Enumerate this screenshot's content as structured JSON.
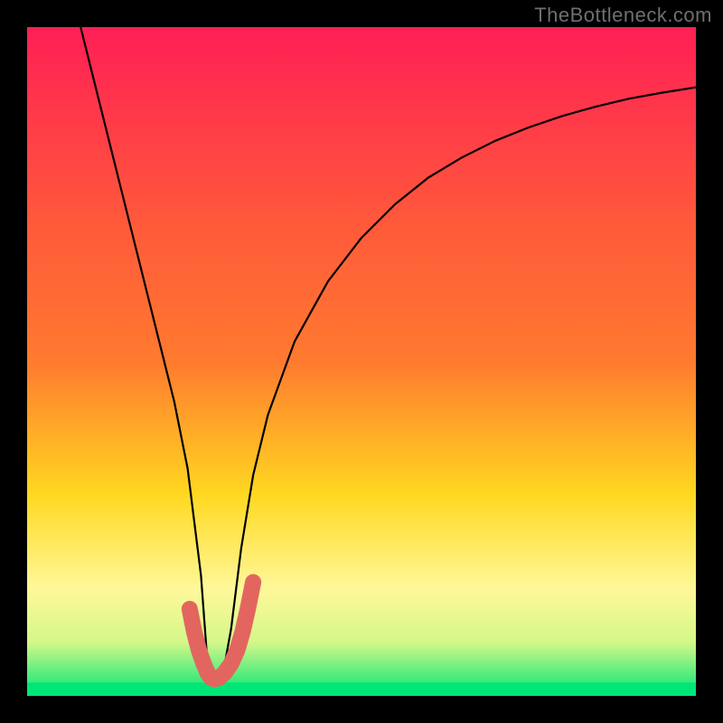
{
  "watermark": "TheBottleneck.com",
  "chart_data": {
    "type": "line",
    "title": "",
    "xlabel": "",
    "ylabel": "",
    "xlim": [
      0,
      100
    ],
    "ylim": [
      0,
      100
    ],
    "background_gradient": {
      "top": "#ff1f55",
      "mid1": "#ff7a2f",
      "mid2": "#ffd820",
      "mid3": "#fff89a",
      "bottom": "#00e676"
    },
    "series": [
      {
        "name": "bottleneck-curve",
        "color": "#000000",
        "x": [
          8,
          10,
          12,
          14,
          16,
          18,
          20,
          22,
          24,
          26,
          27.0,
          27.5,
          28.0,
          28.7,
          29.5,
          30.5,
          32.0,
          33.8,
          36.0,
          40.0,
          45.0,
          50.0,
          55.0,
          60.0,
          65.0,
          70.0,
          75.0,
          80.0,
          85.0,
          90.0,
          95.0,
          100.0
        ],
        "y": [
          100,
          92,
          84,
          76,
          68,
          60,
          52,
          44,
          34,
          18,
          4.5,
          2.8,
          2.5,
          2.8,
          4.5,
          10,
          22,
          33,
          42,
          53,
          62,
          68.5,
          73.5,
          77.5,
          80.5,
          83.0,
          85.0,
          86.7,
          88.1,
          89.3,
          90.2,
          91.0
        ]
      },
      {
        "name": "sweet-spot",
        "color": "#e2665f",
        "thick": true,
        "x": [
          24.3,
          25.0,
          25.7,
          26.4,
          27.0,
          27.5,
          28.0,
          28.7,
          29.5,
          30.5,
          31.4,
          32.2,
          33.0,
          33.8
        ],
        "y": [
          13.0,
          9.5,
          6.8,
          4.8,
          3.4,
          2.7,
          2.5,
          2.7,
          3.4,
          4.8,
          6.8,
          9.5,
          13.0,
          17.0
        ]
      }
    ],
    "green_band": {
      "from_y": 0,
      "to_y": 2
    }
  }
}
